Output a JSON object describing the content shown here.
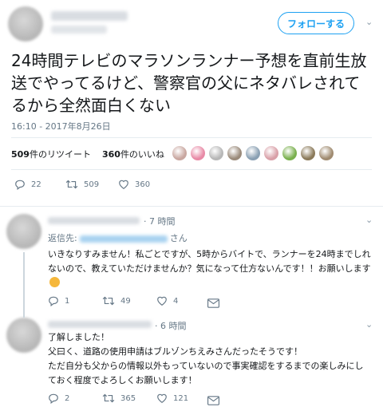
{
  "tweet": {
    "follow_label": "フォローする",
    "text": "24時間テレビのマラソンランナー予想を直前生放送でやってるけど、警察官の父にネタバレされてるから全然面白くない",
    "timestamp": "16:10 - 2017年8月26日",
    "retweets_count": "509",
    "retweets_label": "件のリツイート",
    "likes_count": "360",
    "likes_label": "件のいいね",
    "actions": {
      "reply": "22",
      "retweet": "509",
      "like": "360"
    },
    "liker_colors": [
      "#c9a7a0",
      "#e88aa6",
      "#b7b7b7",
      "#9a8a7a",
      "#8aa0b3",
      "#d9a0a8",
      "#7ab04e",
      "#8b7a5a",
      "#a08b70"
    ]
  },
  "replies": [
    {
      "time": "7 時間",
      "reply_to_prefix": "返信先:",
      "reply_to_suffix": "さん",
      "text": "いきなりすみません！私ごとですが、5時からバイトで、ランナーを24時までしれないので、教えていただけませんか？気になって仕方ないんです！！お願いします",
      "actions": {
        "reply": "1",
        "retweet": "49",
        "like": "4"
      }
    },
    {
      "time": "6 時間",
      "text_lines": [
        "了解しました！",
        "父曰く、道路の使用申請はブルゾンちえみさんだったそうです！",
        "ただ自分も父からの情報以外もっていないので事実確認をするまでの楽しみにし",
        "ておく程度でよろしくお願いします！"
      ],
      "actions": {
        "reply": "2",
        "retweet": "365",
        "like": "121"
      }
    }
  ],
  "colors": {
    "accent": "#1da1f2",
    "muted": "#657786",
    "divider": "#e6ecf0"
  }
}
